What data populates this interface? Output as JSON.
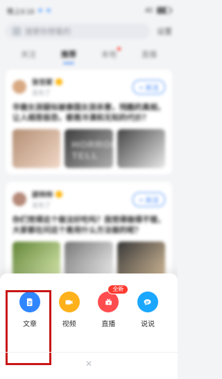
{
  "background": {
    "status_bar": {
      "time": "晚上6:16",
      "right": "40"
    },
    "search": {
      "placeholder": "搜索你想看的",
      "settings_label": "设置"
    },
    "tabs": [
      {
        "label": "关注"
      },
      {
        "label": "推荐"
      },
      {
        "label": "本地"
      },
      {
        "label": "直播"
      }
    ],
    "cards": [
      {
        "author": "张世家",
        "subtitle": "发布了",
        "follow": "+ 关注",
        "title": "华裔女孩疑似被泰国女孩杀害，残酷的真相，让人细思极恐，都是冷漠和无知的代价？",
        "thumb_mark": "HORROR TELL"
      },
      {
        "author": "邵帅帅",
        "subtitle": "发布了",
        "follow": "+ 关注",
        "title": "你们觉得这个做法好吃吗？我觉得做得不错，大家都在问这个是用什么方法做的呢？"
      }
    ]
  },
  "sheet": {
    "actions": [
      {
        "key": "article",
        "label": "文章",
        "icon": "document-icon",
        "color": "#2f86ff"
      },
      {
        "key": "video",
        "label": "视频",
        "icon": "video-icon",
        "color": "#ffb11b"
      },
      {
        "key": "live",
        "label": "直播",
        "icon": "live-tv-icon",
        "color": "#ff4d4f",
        "badge": "全新"
      },
      {
        "key": "talk",
        "label": "说说",
        "icon": "chat-bubble-icon",
        "color": "#1aa7ff"
      }
    ],
    "close": {
      "label": "×"
    }
  }
}
